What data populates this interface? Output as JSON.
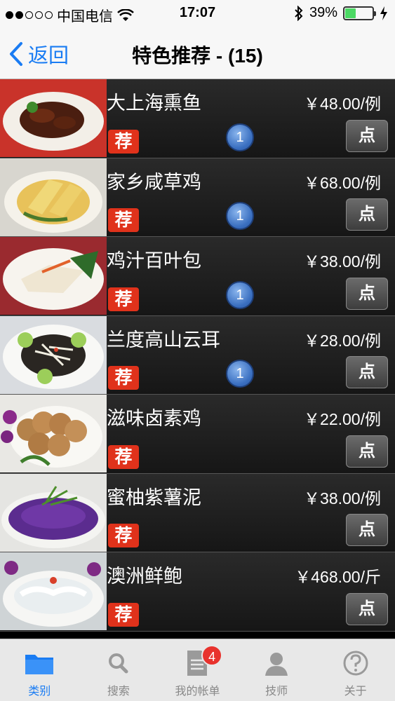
{
  "status": {
    "carrier": "中国电信",
    "time": "17:07",
    "battery": "39%",
    "battery_level": 0.39
  },
  "nav": {
    "back_label": "返回",
    "title": "特色推荐 - (15)"
  },
  "tag_label": "荐",
  "order_label": "点",
  "dishes": [
    {
      "name": "大上海熏鱼",
      "price": "￥48.00/例",
      "qty": "1"
    },
    {
      "name": "家乡咸草鸡",
      "price": "￥68.00/例",
      "qty": "1"
    },
    {
      "name": "鸡汁百叶包",
      "price": "￥38.00/例",
      "qty": "1"
    },
    {
      "name": "兰度高山云耳",
      "price": "￥28.00/例",
      "qty": "1"
    },
    {
      "name": "滋味卤素鸡",
      "price": "￥22.00/例",
      "qty": ""
    },
    {
      "name": "蜜柚紫薯泥",
      "price": "￥38.00/例",
      "qty": ""
    },
    {
      "name": "澳洲鲜鲍",
      "price": "￥468.00/斤",
      "qty": ""
    }
  ],
  "tabs": [
    {
      "label": "类别",
      "icon": "folder-icon",
      "active": true
    },
    {
      "label": "搜索",
      "icon": "search-icon"
    },
    {
      "label": "我的帐单",
      "icon": "document-icon",
      "badge": "4"
    },
    {
      "label": "技师",
      "icon": "person-icon"
    },
    {
      "label": "关于",
      "icon": "question-icon"
    }
  ],
  "colors": {
    "accent": "#1a7cf3",
    "tag_red": "#e0321b",
    "badge_red": "#e8322d"
  }
}
